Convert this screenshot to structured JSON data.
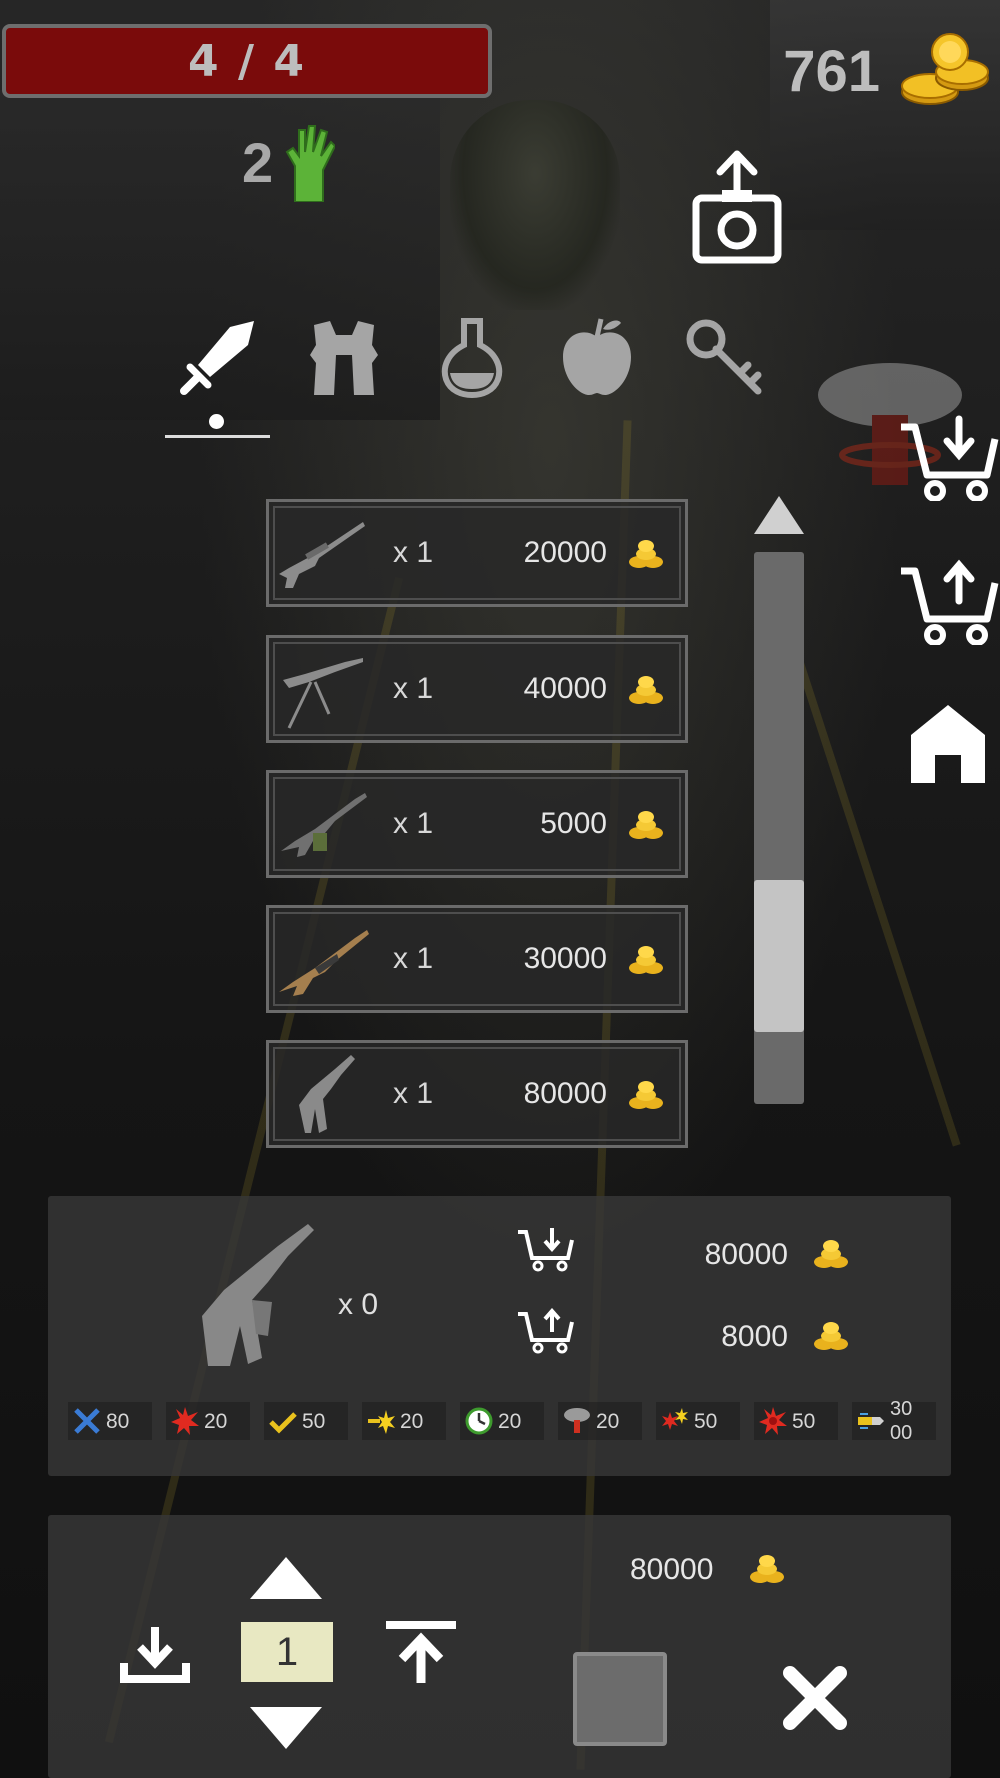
{
  "hud": {
    "health_text": "4 / 4",
    "coins": "761",
    "kills": "2",
    "health_color": "#7a0b0b"
  },
  "icons": {
    "coin": "coin-stack-icon",
    "kills": "zombie-hand-icon",
    "screenshot": "camera-upload-icon"
  },
  "categories": [
    {
      "name": "weapons",
      "icon": "sword-icon",
      "selected": true
    },
    {
      "name": "armor",
      "icon": "vest-icon",
      "selected": false
    },
    {
      "name": "potions",
      "icon": "flask-icon",
      "selected": false
    },
    {
      "name": "food",
      "icon": "apple-icon",
      "selected": false
    },
    {
      "name": "keys",
      "icon": "key-icon",
      "selected": false
    }
  ],
  "side_buttons": [
    {
      "name": "buy",
      "icon": "cart-download-icon"
    },
    {
      "name": "sell",
      "icon": "cart-upload-icon"
    },
    {
      "name": "home",
      "icon": "home-icon"
    }
  ],
  "items": [
    {
      "icon": "sniper-rifle-icon",
      "qty": "x 1",
      "price": "20000"
    },
    {
      "icon": "machine-gun-icon",
      "qty": "x 1",
      "price": "40000"
    },
    {
      "icon": "light-machine-gun-icon",
      "qty": "x 1",
      "price": "5000"
    },
    {
      "icon": "assault-rifle-icon",
      "qty": "x 1",
      "price": "30000"
    },
    {
      "icon": "smg-icon",
      "qty": "x 1",
      "price": "80000"
    }
  ],
  "scroll": {
    "position": 0.82
  },
  "detail": {
    "icon": "smg-icon",
    "qty": "x 0",
    "buy_price": "80000",
    "sell_price": "8000",
    "stats": [
      {
        "icon": "crossed-swords-icon",
        "value": "80"
      },
      {
        "icon": "explosion-icon",
        "value": "20"
      },
      {
        "icon": "check-icon",
        "value": "50"
      },
      {
        "icon": "bullet-burst-icon",
        "value": "20"
      },
      {
        "icon": "timer-icon",
        "value": "20"
      },
      {
        "icon": "nuke-icon",
        "value": "20"
      },
      {
        "icon": "double-burst-icon",
        "value": "50"
      },
      {
        "icon": "red-burst-icon",
        "value": "50"
      },
      {
        "icon": "ammo-icon",
        "value": "3000"
      }
    ]
  },
  "purchase": {
    "total": "80000",
    "quantity": "1"
  }
}
